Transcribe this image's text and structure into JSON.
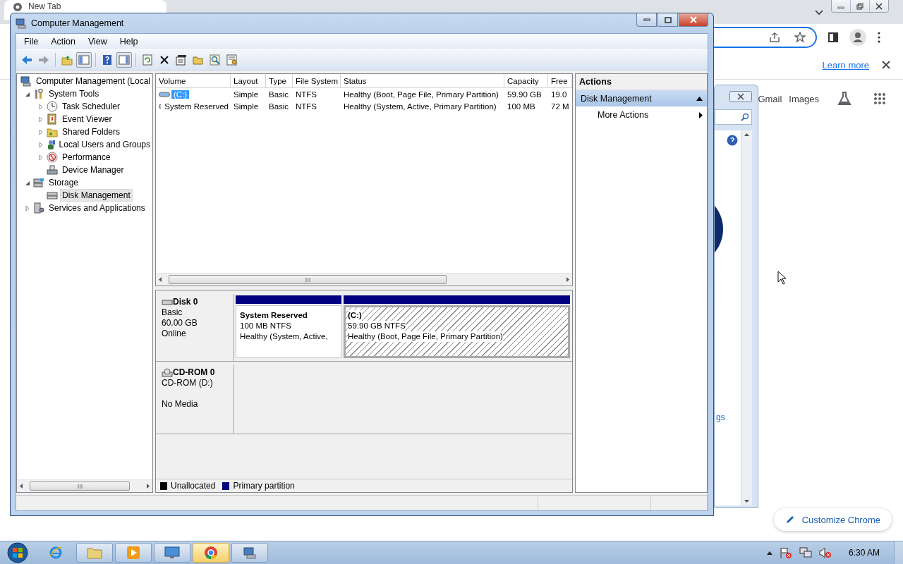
{
  "browser": {
    "tab": {
      "title": "New Tab"
    },
    "info_bar": {
      "link": "Learn more"
    },
    "shortcuts": [
      "Gmail",
      "Images"
    ],
    "customize_button": "Customize Chrome"
  },
  "background_window": {
    "link_fragment": "gs"
  },
  "window": {
    "title": "Computer Management",
    "menu": [
      "File",
      "Action",
      "View",
      "Help"
    ],
    "toolbar": [
      {
        "kind": "back",
        "disabled": false
      },
      {
        "kind": "forward",
        "disabled": true
      },
      {
        "kind": "up"
      },
      {
        "kind": "tree",
        "pressed": true
      },
      {
        "kind": "help"
      },
      {
        "kind": "pane",
        "pressed": true
      },
      {
        "kind": "refresh"
      },
      {
        "kind": "delete"
      },
      {
        "kind": "properties"
      },
      {
        "kind": "open"
      },
      {
        "kind": "find"
      },
      {
        "kind": "settings"
      }
    ],
    "tree": [
      {
        "label": "Computer Management (Local",
        "kind": "computer",
        "selected": false,
        "children": [
          {
            "label": "System Tools",
            "kind": "tools",
            "expanded": true,
            "selected": false,
            "children": [
              {
                "label": "Task Scheduler",
                "kind": "clock",
                "expanded": false,
                "selected": false
              },
              {
                "label": "Event Viewer",
                "kind": "log",
                "expanded": false,
                "selected": false
              },
              {
                "label": "Shared Folders",
                "kind": "folder",
                "expanded": false,
                "selected": false
              },
              {
                "label": "Local Users and Groups",
                "kind": "users",
                "expanded": false,
                "selected": false
              },
              {
                "label": "Performance",
                "kind": "gauge",
                "expanded": false,
                "selected": false
              },
              {
                "label": "Device Manager",
                "kind": "device",
                "selected": false
              }
            ]
          },
          {
            "label": "Storage",
            "kind": "storage",
            "expanded": true,
            "selected": false,
            "children": [
              {
                "label": "Disk Management",
                "kind": "disk",
                "selected": true
              }
            ]
          },
          {
            "label": "Services and Applications",
            "kind": "services",
            "expanded": false,
            "selected": false
          }
        ]
      }
    ],
    "volumes": {
      "columns": [
        "Volume",
        "Layout",
        "Type",
        "File System",
        "Status",
        "Capacity",
        "Free"
      ],
      "rows": [
        {
          "selected": true,
          "cells": [
            "(C:)",
            "Simple",
            "Basic",
            "NTFS",
            "Healthy (Boot, Page File, Primary Partition)",
            "59.90 GB",
            "19.0"
          ]
        },
        {
          "selected": false,
          "cells": [
            "System Reserved",
            "Simple",
            "Basic",
            "NTFS",
            "Healthy (System, Active, Primary Partition)",
            "100 MB",
            "72 M"
          ]
        }
      ]
    },
    "disks": [
      {
        "kind": "disk",
        "name": "Disk 0",
        "type": "Basic",
        "size": "60.00 GB",
        "status": "Online",
        "partitions": [
          {
            "name": "System Reserved",
            "size": "100 MB NTFS",
            "status": "Healthy (System, Active,",
            "selected": false
          },
          {
            "name": "(C:)",
            "size": "59.90 GB NTFS",
            "status": "Healthy (Boot, Page File, Primary Partition)",
            "selected": true
          }
        ]
      },
      {
        "kind": "cdrom",
        "name": "CD-ROM 0",
        "type": "CD-ROM (D:)",
        "status": "No Media"
      }
    ],
    "legend": [
      {
        "label": "Unallocated",
        "color": "#000000"
      },
      {
        "label": "Primary partition",
        "color": "#000080"
      }
    ],
    "actions": {
      "title": "Actions",
      "section": {
        "label": "Disk Management",
        "expanded": true
      },
      "items": [
        "More Actions"
      ]
    }
  },
  "taskbar": {
    "apps": [
      {
        "kind": "ie",
        "running": false,
        "selected": false
      },
      {
        "kind": "explorer",
        "running": true,
        "selected": false
      },
      {
        "kind": "media",
        "running": true,
        "selected": false
      },
      {
        "kind": "remote",
        "running": true,
        "selected": false
      },
      {
        "kind": "chrome",
        "running": true,
        "selected": true
      },
      {
        "kind": "mmc",
        "running": true,
        "selected": false
      }
    ],
    "clock": "6:30 AM"
  }
}
